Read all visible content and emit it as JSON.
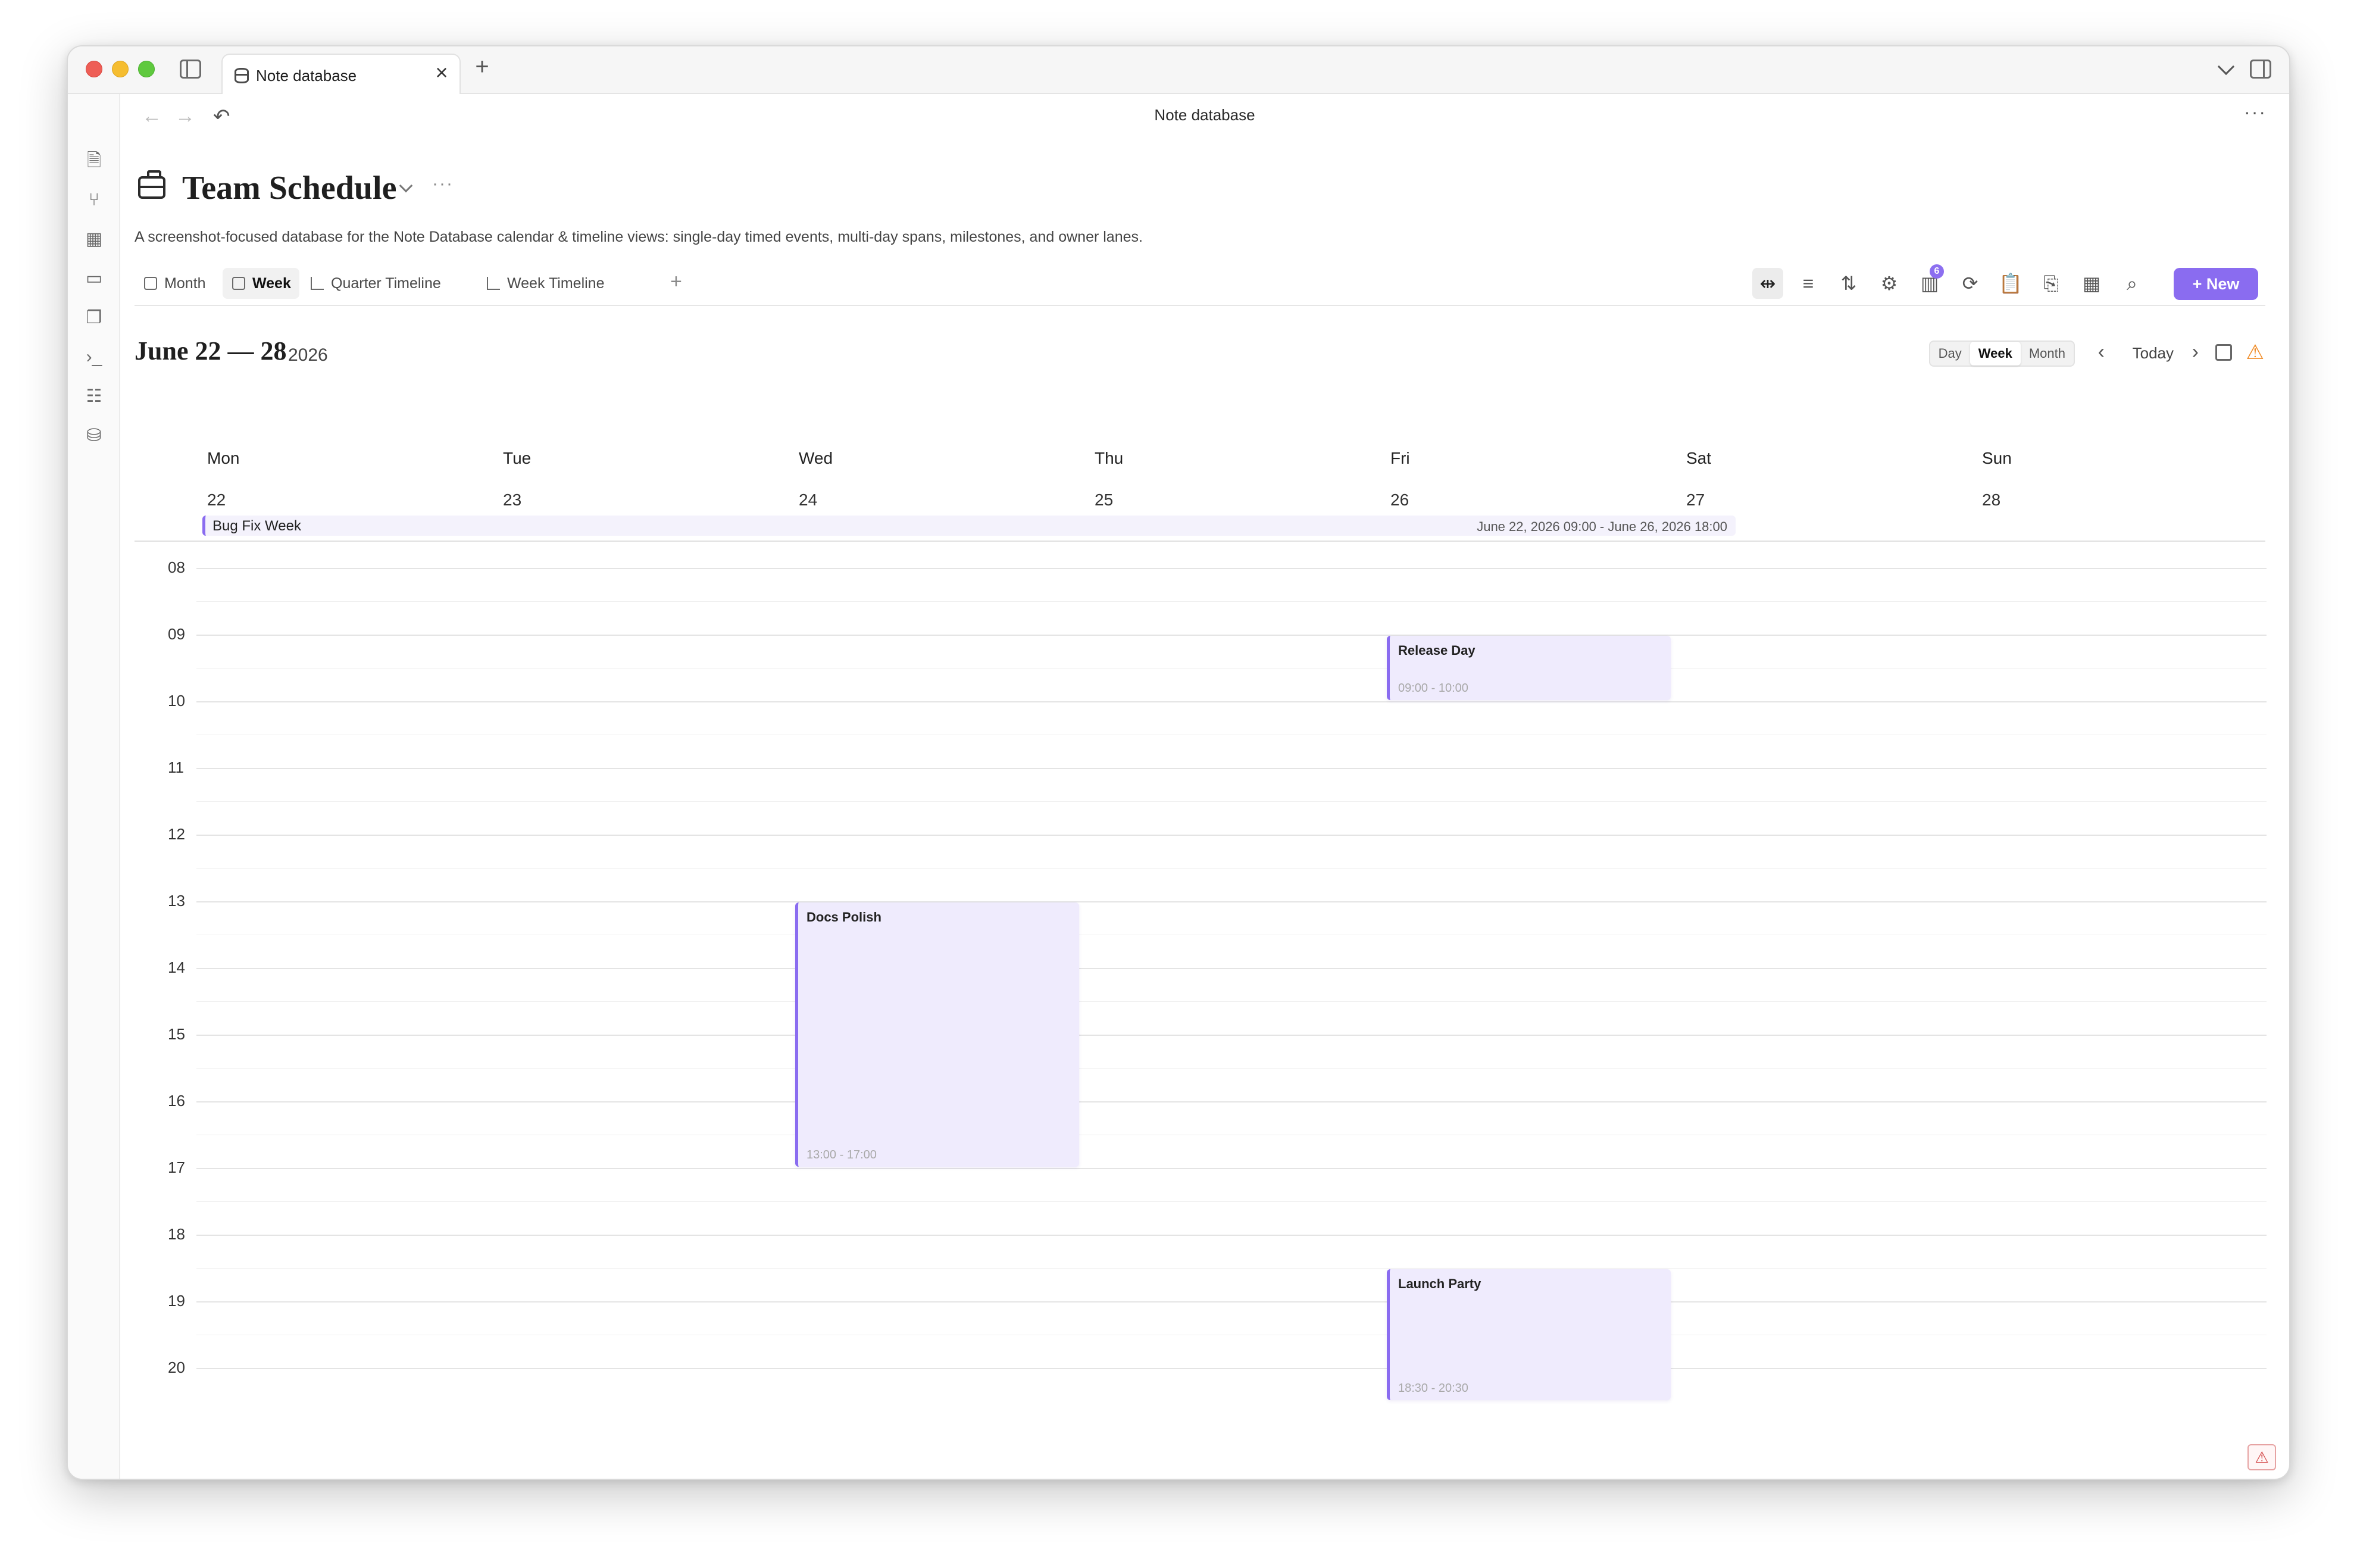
{
  "window": {
    "tab_title": "Note database",
    "nav_title": "Note database"
  },
  "header": {
    "title": "Team Schedule",
    "description": "A screenshot-focused database for the Note Database calendar & timeline views: single-day timed events, multi-day spans, milestones, and owner lanes."
  },
  "views": [
    {
      "label": "Month",
      "active": false
    },
    {
      "label": "Week",
      "active": true
    },
    {
      "label": "Quarter Timeline",
      "active": false
    },
    {
      "label": "Week Timeline",
      "active": false
    }
  ],
  "toolbar": {
    "new_label": "New",
    "columns_badge": "6"
  },
  "calendar": {
    "range_label": "June 22 — 28",
    "year_label": "2026",
    "mode_buttons": [
      {
        "label": "Day",
        "active": false
      },
      {
        "label": "Week",
        "active": true
      },
      {
        "label": "Month",
        "active": false
      }
    ],
    "today_label": "Today",
    "days": [
      {
        "name": "Mon",
        "date": "22"
      },
      {
        "name": "Tue",
        "date": "23"
      },
      {
        "name": "Wed",
        "date": "24"
      },
      {
        "name": "Thu",
        "date": "25"
      },
      {
        "name": "Fri",
        "date": "26"
      },
      {
        "name": "Sat",
        "date": "27"
      },
      {
        "name": "Sun",
        "date": "28"
      }
    ],
    "hours": [
      "08",
      "09",
      "10",
      "11",
      "12",
      "13",
      "14",
      "15",
      "16",
      "17",
      "18",
      "19",
      "20"
    ],
    "all_day_event": {
      "title": "Bug Fix Week",
      "range": "June 22, 2026 09:00 - June 26, 2026 18:00"
    },
    "events": [
      {
        "title": "Release Day",
        "time": "09:00 - 10:00",
        "day": "Fri",
        "start": 9,
        "end": 10
      },
      {
        "title": "Docs Polish",
        "time": "13:00 - 17:00",
        "day": "Wed",
        "start": 13,
        "end": 17
      },
      {
        "title": "Launch Party",
        "time": "18:30 - 20:30",
        "day": "Fri",
        "start": 18.5,
        "end": 20.5
      }
    ]
  },
  "colors": {
    "accent": "#8a6cf0",
    "event_bg": "#efebfd"
  }
}
